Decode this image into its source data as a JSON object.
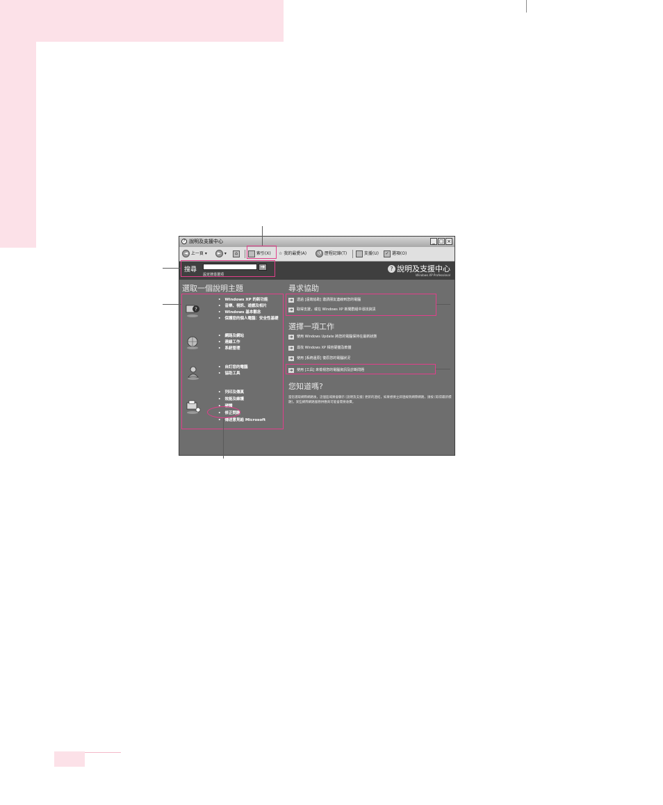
{
  "window": {
    "title": "說明及支援中心",
    "toolbar": {
      "back": "上一頁",
      "index": "索引(X)",
      "favorites": "我的最愛(A)",
      "history": "歷程記錄(T)",
      "support": "支援(U)",
      "options": "選項(O)"
    },
    "header": {
      "search_label": "搜尋",
      "search_value": "",
      "search_options": "設定搜尋選項",
      "brand": "說明及支援中心",
      "edition": "Windows XP Professional"
    },
    "topics": {
      "heading": "選取一個說明主題",
      "groups": [
        {
          "icon": "help-topic-icon",
          "items": [
            "Windows XP 的新功能",
            "音樂、視訊、遊戲及相片",
            "Windows 基本觀念",
            "保護您的個人電腦：安全性基礎"
          ]
        },
        {
          "icon": "network-icon",
          "items": [
            "網路及網站",
            "連線工作",
            "系統管理"
          ]
        },
        {
          "icon": "user-icon",
          "items": [
            "自訂您的電腦",
            "協助工具"
          ]
        },
        {
          "icon": "printer-icon",
          "items": [
            "列印及傳真",
            "效能及維護",
            "硬體",
            "修正問題",
            "傳送意見給 Microsoft"
          ]
        }
      ]
    },
    "assistance": {
      "heading": "尋求協助",
      "links": [
        "透過 [遠端協助] 邀請朋友連線到您的電腦",
        "取得支援，或在 Windows XP 新聞群組中尋找資訊"
      ]
    },
    "tasks": {
      "heading": "選擇一項工作",
      "links": [
        "使用 Windows Update 將您的電腦保持在最新狀態",
        "尋找 Windows XP 相容硬體及軟體",
        "使用 [系統還原] 復原您的電腦狀況",
        "使用 [工具] 來檢視您的電腦資訊及診斷問題"
      ]
    },
    "did_you_know": {
      "heading": "您知道嗎?",
      "text": "當您選取網際網路後，這個區域將會顯示 [說明及支援] 更新的連結，如果想要立即連線到網際網路，請按 [取得最新標題]，某些網際網路服務供應商可能會需要收費。"
    }
  }
}
